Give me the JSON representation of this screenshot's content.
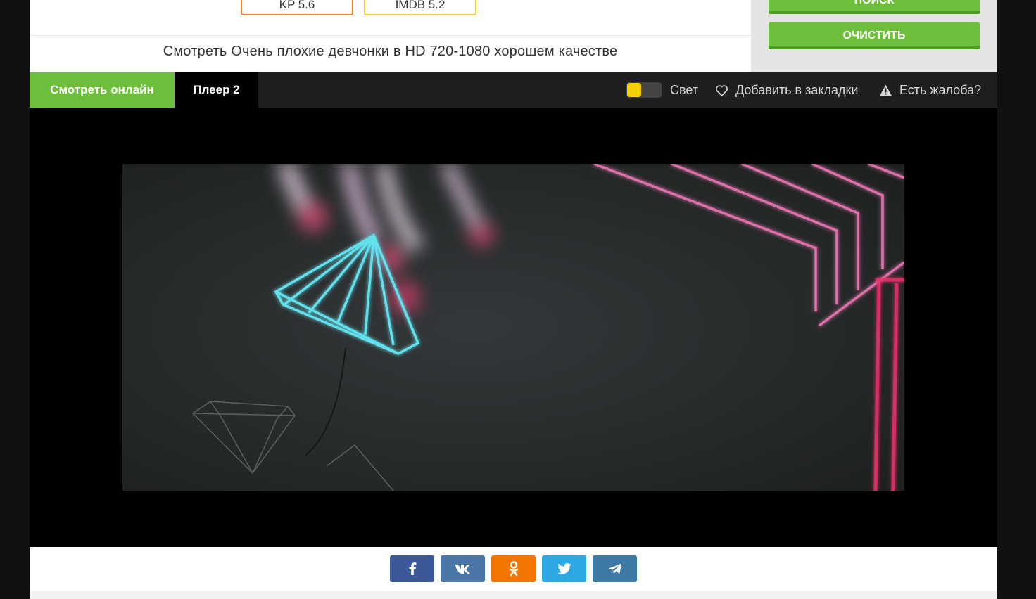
{
  "ratings": {
    "kp": "KP 5.6",
    "imdb": "IMDB 5.2"
  },
  "sidebar": {
    "search_label": "ПОИСК",
    "clear_label": "ОЧИСТИТЬ"
  },
  "title": "Смотреть Очень плохие девчонки в HD 720-1080 хорошем качестве",
  "player": {
    "tabs": [
      "Смотреть онлайн",
      "Плеер 2"
    ],
    "light_label": "Свет",
    "bookmark_label": "Добавить в закладки",
    "complaint_label": "Есть жалоба?"
  },
  "share": {
    "buttons": [
      {
        "icon": "facebook-icon",
        "color": "#3b5998"
      },
      {
        "icon": "vk-icon",
        "color": "#4a76a8"
      },
      {
        "icon": "odnoklassniki-icon",
        "color": "#f47500"
      },
      {
        "icon": "twitter-icon",
        "color": "#2ea8e3"
      },
      {
        "icon": "telegram-icon",
        "color": "#3e7aa5"
      }
    ]
  },
  "colors": {
    "accent_green": "#6dbf3b",
    "kp_orange": "#f57a2b",
    "imdb_yellow": "#f5cd2b",
    "toggle_yellow": "#f5d000"
  }
}
